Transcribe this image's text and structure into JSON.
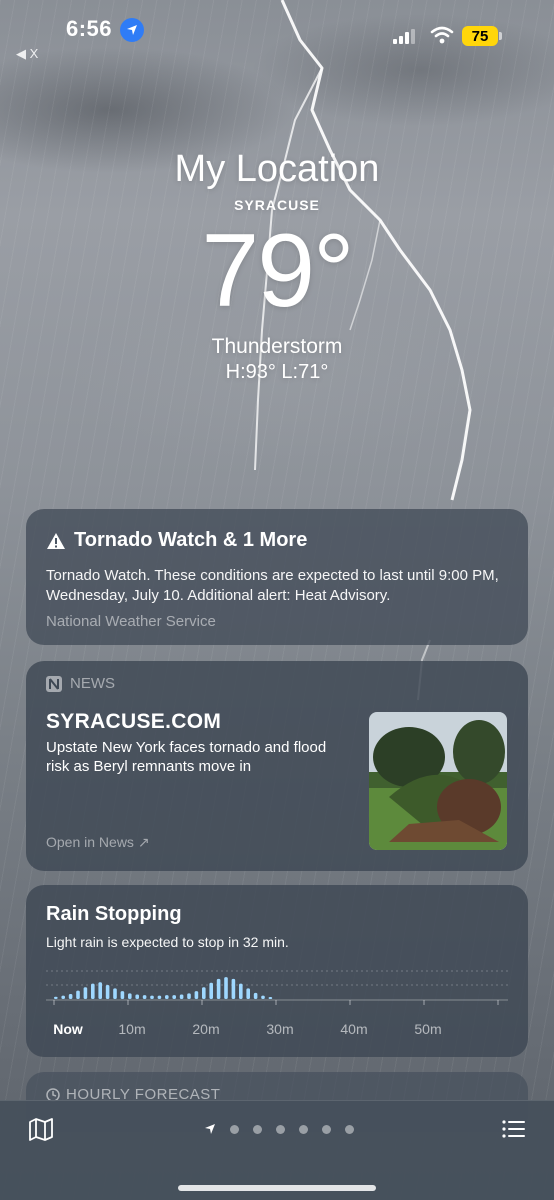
{
  "status_bar": {
    "time": "6:56",
    "battery": "75",
    "back_label": "◀ X"
  },
  "header": {
    "title": "My Location",
    "city": "SYRACUSE",
    "temperature": "79°",
    "condition": "Thunderstorm",
    "high_low": "H:93°  L:71°"
  },
  "alert": {
    "title": "Tornado Watch & 1 More",
    "body": "Tornado Watch. These conditions are expected to last until 9:00 PM, Wednesday, July 10. Additional alert: Heat Advisory.",
    "source": "National Weather Service"
  },
  "news": {
    "section": "NEWS",
    "brand": "SYRACUSE.COM",
    "headline": "Upstate New York faces tornado and flood risk as Beryl remnants move in",
    "open_label": "Open in News ↗"
  },
  "rain": {
    "title": "Rain Stopping",
    "description": "Light rain is expected to stop in 32 min.",
    "axis_labels": [
      "Now",
      "10m",
      "20m",
      "30m",
      "40m",
      "50m"
    ],
    "intensity": [
      0.08,
      0.12,
      0.18,
      0.3,
      0.42,
      0.55,
      0.6,
      0.5,
      0.38,
      0.28,
      0.2,
      0.16,
      0.14,
      0.12,
      0.12,
      0.14,
      0.14,
      0.16,
      0.2,
      0.28,
      0.42,
      0.58,
      0.72,
      0.78,
      0.72,
      0.55,
      0.38,
      0.22,
      0.12,
      0.06
    ]
  },
  "hourly": {
    "label": "HOURLY FORECAST"
  },
  "colors": {
    "accent_blue": "#2f7cf6",
    "battery_yellow": "#ffd60a",
    "rain_bar": "#9fd8ff"
  },
  "icons": {
    "location": "location-arrow-icon",
    "warning": "warning-triangle-icon",
    "news": "apple-news-icon",
    "map": "map-icon",
    "list": "list-icon"
  }
}
